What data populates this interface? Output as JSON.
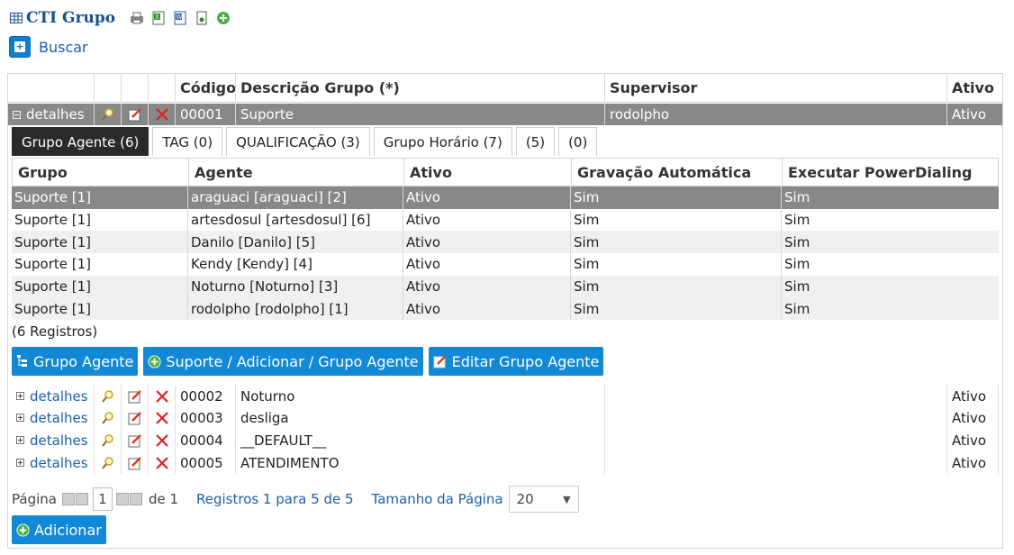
{
  "header": {
    "title": "CTI Grupo",
    "tools": [
      "print-icon",
      "excel-icon",
      "word-icon",
      "export-icon",
      "add-circle-icon"
    ]
  },
  "buscar_label": "Buscar",
  "grid": {
    "columns": [
      "",
      "",
      "",
      "",
      "Código",
      "Descrição Grupo (*)",
      "Supervisor",
      "Ativo"
    ],
    "expanded_row": {
      "detail": "detalhes",
      "code": "00001",
      "desc": "Suporte",
      "supervisor": "rodolpho",
      "active": "Ativo"
    },
    "tabs": [
      "Grupo Agente (6)",
      "TAG (0)",
      "QUALIFICAÇÃO (3)",
      "Grupo Horário (7)",
      "(5)",
      "(0)"
    ],
    "inner": {
      "columns": [
        "Grupo",
        "Agente",
        "Ativo",
        "Gravação Automática",
        "Executar PowerDialing"
      ],
      "rows": [
        [
          "Suporte [1]",
          "araguaci [araguaci] [2]",
          "Ativo",
          "Sim",
          "Sim"
        ],
        [
          "Suporte [1]",
          "artesdosul [artesdosul] [6]",
          "Ativo",
          "Sim",
          "Sim"
        ],
        [
          "Suporte [1]",
          "Danilo [Danilo] [5]",
          "Ativo",
          "Sim",
          "Sim"
        ],
        [
          "Suporte [1]",
          "Kendy [Kendy] [4]",
          "Ativo",
          "Sim",
          "Sim"
        ],
        [
          "Suporte [1]",
          "Noturno [Noturno] [3]",
          "Ativo",
          "Sim",
          "Sim"
        ],
        [
          "Suporte [1]",
          "rodolpho [rodolpho] [1]",
          "Ativo",
          "Sim",
          "Sim"
        ]
      ],
      "count": "(6 Registros)",
      "buttons": [
        "Grupo Agente",
        "Suporte / Adicionar / Grupo Agente",
        "Editar Grupo Agente"
      ]
    },
    "rows": [
      {
        "detail": "detalhes",
        "code": "00002",
        "desc": "Noturno",
        "supervisor": "",
        "active": "Ativo"
      },
      {
        "detail": "detalhes",
        "code": "00003",
        "desc": "desliga",
        "supervisor": "",
        "active": "Ativo"
      },
      {
        "detail": "detalhes",
        "code": "00004",
        "desc": "__DEFAULT__",
        "supervisor": "",
        "active": "Ativo"
      },
      {
        "detail": "detalhes",
        "code": "00005",
        "desc": "ATENDIMENTO",
        "supervisor": "",
        "active": "Ativo"
      }
    ]
  },
  "pager": {
    "page_label": "Página",
    "page": "1",
    "of": "de 1",
    "records": "Registros 1 para 5 de 5",
    "size_label": "Tamanho da Página",
    "size": "20"
  },
  "add_label": "Adicionar",
  "colors": {
    "selected": "#888888",
    "button": "#1289d6",
    "link": "#1a5fb0",
    "title": "#1a4f8f"
  }
}
